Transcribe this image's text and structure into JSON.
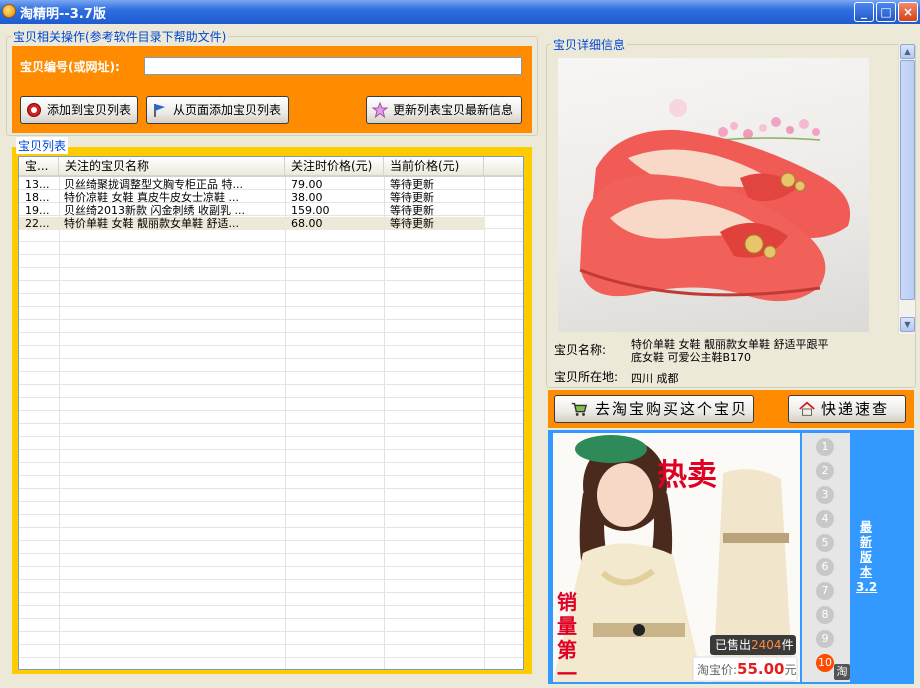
{
  "window": {
    "title": "淘精明--3.7版",
    "minimize": "_",
    "maximize": "□",
    "close": "×"
  },
  "operations": {
    "group_title": "宝贝相关操作(参考软件目录下帮助文件)",
    "id_label": "宝贝编号(或网址):",
    "id_value": "",
    "add_button": "添加到宝贝列表",
    "add_from_page_button": "从页面添加宝贝列表",
    "refresh_button": "更新列表宝贝最新信息"
  },
  "list": {
    "group_title": "宝贝列表",
    "columns": [
      "宝...",
      "关注的宝贝名称",
      "关注时价格(元)",
      "当前价格(元)"
    ],
    "rows": [
      {
        "id": "13...",
        "name": "贝丝绮聚拢调整型文胸专柜正品 特...",
        "watch_price": "79.00",
        "current_price": "等待更新"
      },
      {
        "id": "18...",
        "name": "特价凉鞋 女鞋 真皮牛皮女士凉鞋 ...",
        "watch_price": "38.00",
        "current_price": "等待更新"
      },
      {
        "id": "19...",
        "name": "贝丝绮2013新款 闪金刺绣 收副乳 ...",
        "watch_price": "159.00",
        "current_price": "等待更新"
      },
      {
        "id": "22...",
        "name": "特价单鞋 女鞋 靓丽款女单鞋 舒适...",
        "watch_price": "68.00",
        "current_price": "等待更新"
      }
    ]
  },
  "details": {
    "group_title": "宝贝详细信息",
    "name_label": "宝贝名称:",
    "name_line1": "特价单鞋 女鞋 靓丽款女单鞋 舒适平跟平",
    "name_line2": "底女鞋 可爱公主鞋B170",
    "location_label": "宝贝所在地:",
    "location_value": "四川   成都",
    "buy_button": "去淘宝购买这个宝贝",
    "express_button": "快递速查"
  },
  "ad": {
    "hot_text": "热卖",
    "side_text": "销量第一",
    "sold_prefix": "已售出",
    "sold_count": "2404",
    "sold_suffix": "件",
    "price_label": "淘宝价:",
    "price_value": "55.00",
    "price_unit": "元",
    "page_numbers": [
      "1",
      "2",
      "3",
      "4",
      "5",
      "6",
      "7",
      "8",
      "9",
      "10"
    ],
    "active_page": "10",
    "tao_badge": "淘",
    "version_link": "最新版本3.2"
  },
  "colors": {
    "orange_panel": "#ff8c00",
    "yellow_frame": "#ffcc00",
    "ad_blue": "#3399ff",
    "legend_blue": "#0046d5",
    "shoe_coral": "#f2605a"
  }
}
